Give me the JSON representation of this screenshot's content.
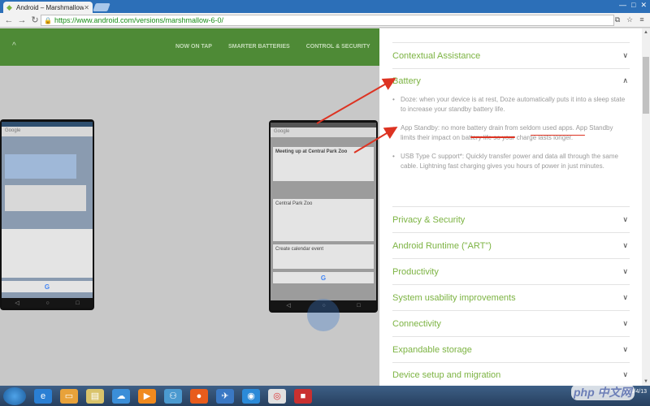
{
  "browser": {
    "tab_title": "Android – Marshmallow",
    "url": "https://www.android.com/versions/marshmallow-6-0/"
  },
  "site_nav": {
    "links": [
      "NOW ON TAP",
      "SMARTER BATTERIES",
      "CONTROL & SECURITY"
    ]
  },
  "phone_right": {
    "search": "Google",
    "headline": "Meeting up at Central Park Zoo",
    "card1": "Central Park Zoo",
    "card2": "Create calendar event"
  },
  "phone_left": {
    "search": "Google"
  },
  "accordion": {
    "contextual": "Contextual Assistance",
    "battery": "Battery",
    "privacy": "Privacy & Security",
    "runtime": "Android Runtime (\"ART\")",
    "productivity": "Productivity",
    "usability": "System usability improvements",
    "connectivity": "Connectivity",
    "storage": "Expandable storage",
    "setup": "Device setup and migration"
  },
  "battery_bullets": {
    "b1": "Doze: when your device is at rest, Doze automatically puts it into a sleep state to increase your standby battery life.",
    "b2": "App Standby: no more battery drain from seldom used apps. App Standby limits their impact on battery life so your charge lasts longer.",
    "b3": "USB Type C support*: Quickly transfer power and data all through the same cable. Lightning fast charging gives you hours of power in just minutes."
  },
  "taskbar": {
    "date": "2016/4/13"
  },
  "watermark": "php 中文网",
  "colors": {
    "accent_green": "#7cb342",
    "nav_green": "#4e8a36",
    "annotation_red": "#dd3322"
  }
}
